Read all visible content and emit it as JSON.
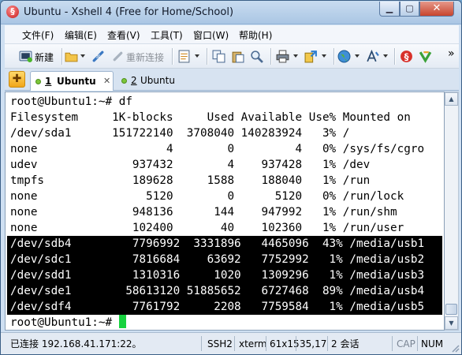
{
  "window": {
    "title": "Ubuntu - Xshell 4 (Free for Home/School)"
  },
  "menu": [
    "文件(F)",
    "编辑(E)",
    "查看(V)",
    "工具(T)",
    "窗口(W)",
    "帮助(H)"
  ],
  "toolbar": {
    "new_label": "新建",
    "reconnect_label": "重新连接",
    "overflow": "»"
  },
  "tabs": [
    {
      "number": "1",
      "label": "Ubuntu",
      "active": true
    },
    {
      "number": "2",
      "label": "Ubuntu",
      "active": false
    }
  ],
  "terminal": {
    "lines": [
      {
        "text": "root@Ubuntu1:~# df",
        "highlight": false
      },
      {
        "text": "Filesystem     1K-blocks     Used Available Use% Mounted on",
        "highlight": false
      },
      {
        "text": "/dev/sda1      151722140  3708040 140283924   3% /",
        "highlight": false
      },
      {
        "text": "none                   4        0         4   0% /sys/fs/cgro",
        "highlight": false
      },
      {
        "text": "udev              937432        4    937428   1% /dev",
        "highlight": false
      },
      {
        "text": "tmpfs             189628     1588    188040   1% /run",
        "highlight": false
      },
      {
        "text": "none                5120        0      5120   0% /run/lock",
        "highlight": false
      },
      {
        "text": "none              948136      144    947992   1% /run/shm",
        "highlight": false
      },
      {
        "text": "none              102400       40    102360   1% /run/user",
        "highlight": false
      },
      {
        "text": "/dev/sdb4         7796992  3331896   4465096  43% /media/usb1",
        "highlight": true
      },
      {
        "text": "/dev/sdc1         7816684    63692   7752992   1% /media/usb2",
        "highlight": true
      },
      {
        "text": "/dev/sdd1         1310316     1020   1309296   1% /media/usb3",
        "highlight": true
      },
      {
        "text": "/dev/sde1        58613120 51885652   6727468  89% /media/usb4",
        "highlight": true
      },
      {
        "text": "/dev/sdf4         7761792     2208   7759584   1% /media/usb5",
        "highlight": true
      }
    ],
    "prompt": "root@Ubuntu1:~# "
  },
  "status": {
    "connection": "已连接 192.168.41.171:22。",
    "protocol": "SSH2",
    "terminal_type": "xterm",
    "size": "61x15",
    "cursor_pos": "35,17",
    "sessions": "2 会话",
    "cap": "CAP",
    "num": "NUM"
  },
  "colors": {
    "cursor": "#16d23e",
    "selection_bg": "#000000",
    "title_bar": "#aac6e4"
  }
}
